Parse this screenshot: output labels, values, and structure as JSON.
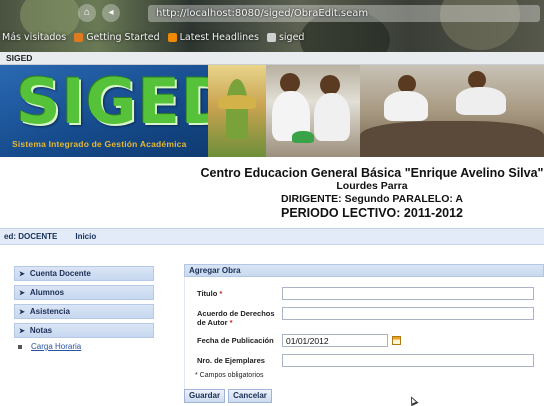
{
  "browser": {
    "url": "http://localhost:8080/siged/ObraEdit.seam",
    "bookmarks": [
      {
        "label": "Más visitados",
        "icon": "star-icon",
        "color": "#c9c9c9"
      },
      {
        "label": "Getting Started",
        "icon": "firefox-icon",
        "color": "#e07a20"
      },
      {
        "label": "Latest Headlines",
        "icon": "rss-icon",
        "color": "#f08a00"
      },
      {
        "label": "siged",
        "icon": "page-icon",
        "color": "#d0d0d0"
      }
    ],
    "tab_title": "SIGED"
  },
  "banner": {
    "logo": "SIGED",
    "subtitle": "Sistema Integrado de Gestión Académica"
  },
  "school": {
    "name": "Centro Educacion General Básica \"Enrique Avelino Silva\"",
    "person": "Lourdes Parra",
    "dirigente": "DIRIGENTE: Segundo PARALELO: A",
    "periodo": "PERIODO LECTIVO: 2011-2012"
  },
  "role_bar": {
    "role": "ed: DOCENTE",
    "home": "Inicio"
  },
  "sidebar": {
    "items": [
      {
        "label": "Cuenta Docente"
      },
      {
        "label": "Alumnos"
      },
      {
        "label": "Asistencia"
      },
      {
        "label": "Notas"
      }
    ],
    "link": "Carga Horaria"
  },
  "form": {
    "title": "Agregar Obra",
    "titulo_label": "Titulo",
    "acuerdo_label_1": "Acuerdo de Derechos",
    "acuerdo_label_2": "de Autor",
    "fecha_label": "Fecha de Publicación",
    "fecha_value": "01/01/2012",
    "ejemplares_label": "Nro. de Ejemplares",
    "required_mark": "*",
    "required_note": "* Campos obligatorios",
    "save_label": "Guardar",
    "cancel_label": "Cancelar"
  },
  "colors": {
    "accent": "#1c2e55",
    "required": "#d02020",
    "logo_green": "#55c23a",
    "banner_blue": "#154a8a"
  }
}
